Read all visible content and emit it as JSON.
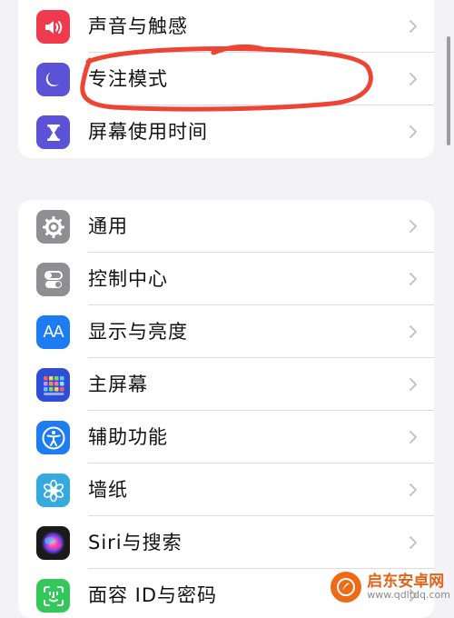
{
  "colors": {
    "background": "#f2f2f7",
    "card": "#ffffff",
    "chevron": "#c4c4c9",
    "annotation": "#ee4433"
  },
  "groups": [
    {
      "items": [
        {
          "label": "声音与触感",
          "icon": "speaker-icon",
          "icon_bg": "#f03a4d"
        },
        {
          "label": "专注模式",
          "icon": "moon-icon",
          "icon_bg": "#5b52d8"
        },
        {
          "label": "屏幕使用时间",
          "icon": "hourglass-icon",
          "icon_bg": "#5b52d8"
        }
      ]
    },
    {
      "items": [
        {
          "label": "通用",
          "icon": "gear-icon",
          "icon_bg": "#8e8e93"
        },
        {
          "label": "控制中心",
          "icon": "toggles-icon",
          "icon_bg": "#8e8e93"
        },
        {
          "label": "显示与亮度",
          "icon": "text-size-icon",
          "icon_bg": "#1e7cf2"
        },
        {
          "label": "主屏幕",
          "icon": "home-grid-icon",
          "icon_bg": "#2f4ed8"
        },
        {
          "label": "辅助功能",
          "icon": "accessibility-icon",
          "icon_bg": "#1e7cf2"
        },
        {
          "label": "墙纸",
          "icon": "flower-icon",
          "icon_bg": "#35aade"
        },
        {
          "label": "Siri与搜索",
          "icon": "siri-icon",
          "icon_bg": "#1a1a1a"
        },
        {
          "label": "面容 ID与密码",
          "icon": "face-id-icon",
          "icon_bg": "#34c759"
        }
      ]
    }
  ],
  "icons": {
    "text_size_glyph": "AA"
  },
  "watermark": {
    "name": "启东安卓网",
    "url": "www.qdltdq.com"
  }
}
